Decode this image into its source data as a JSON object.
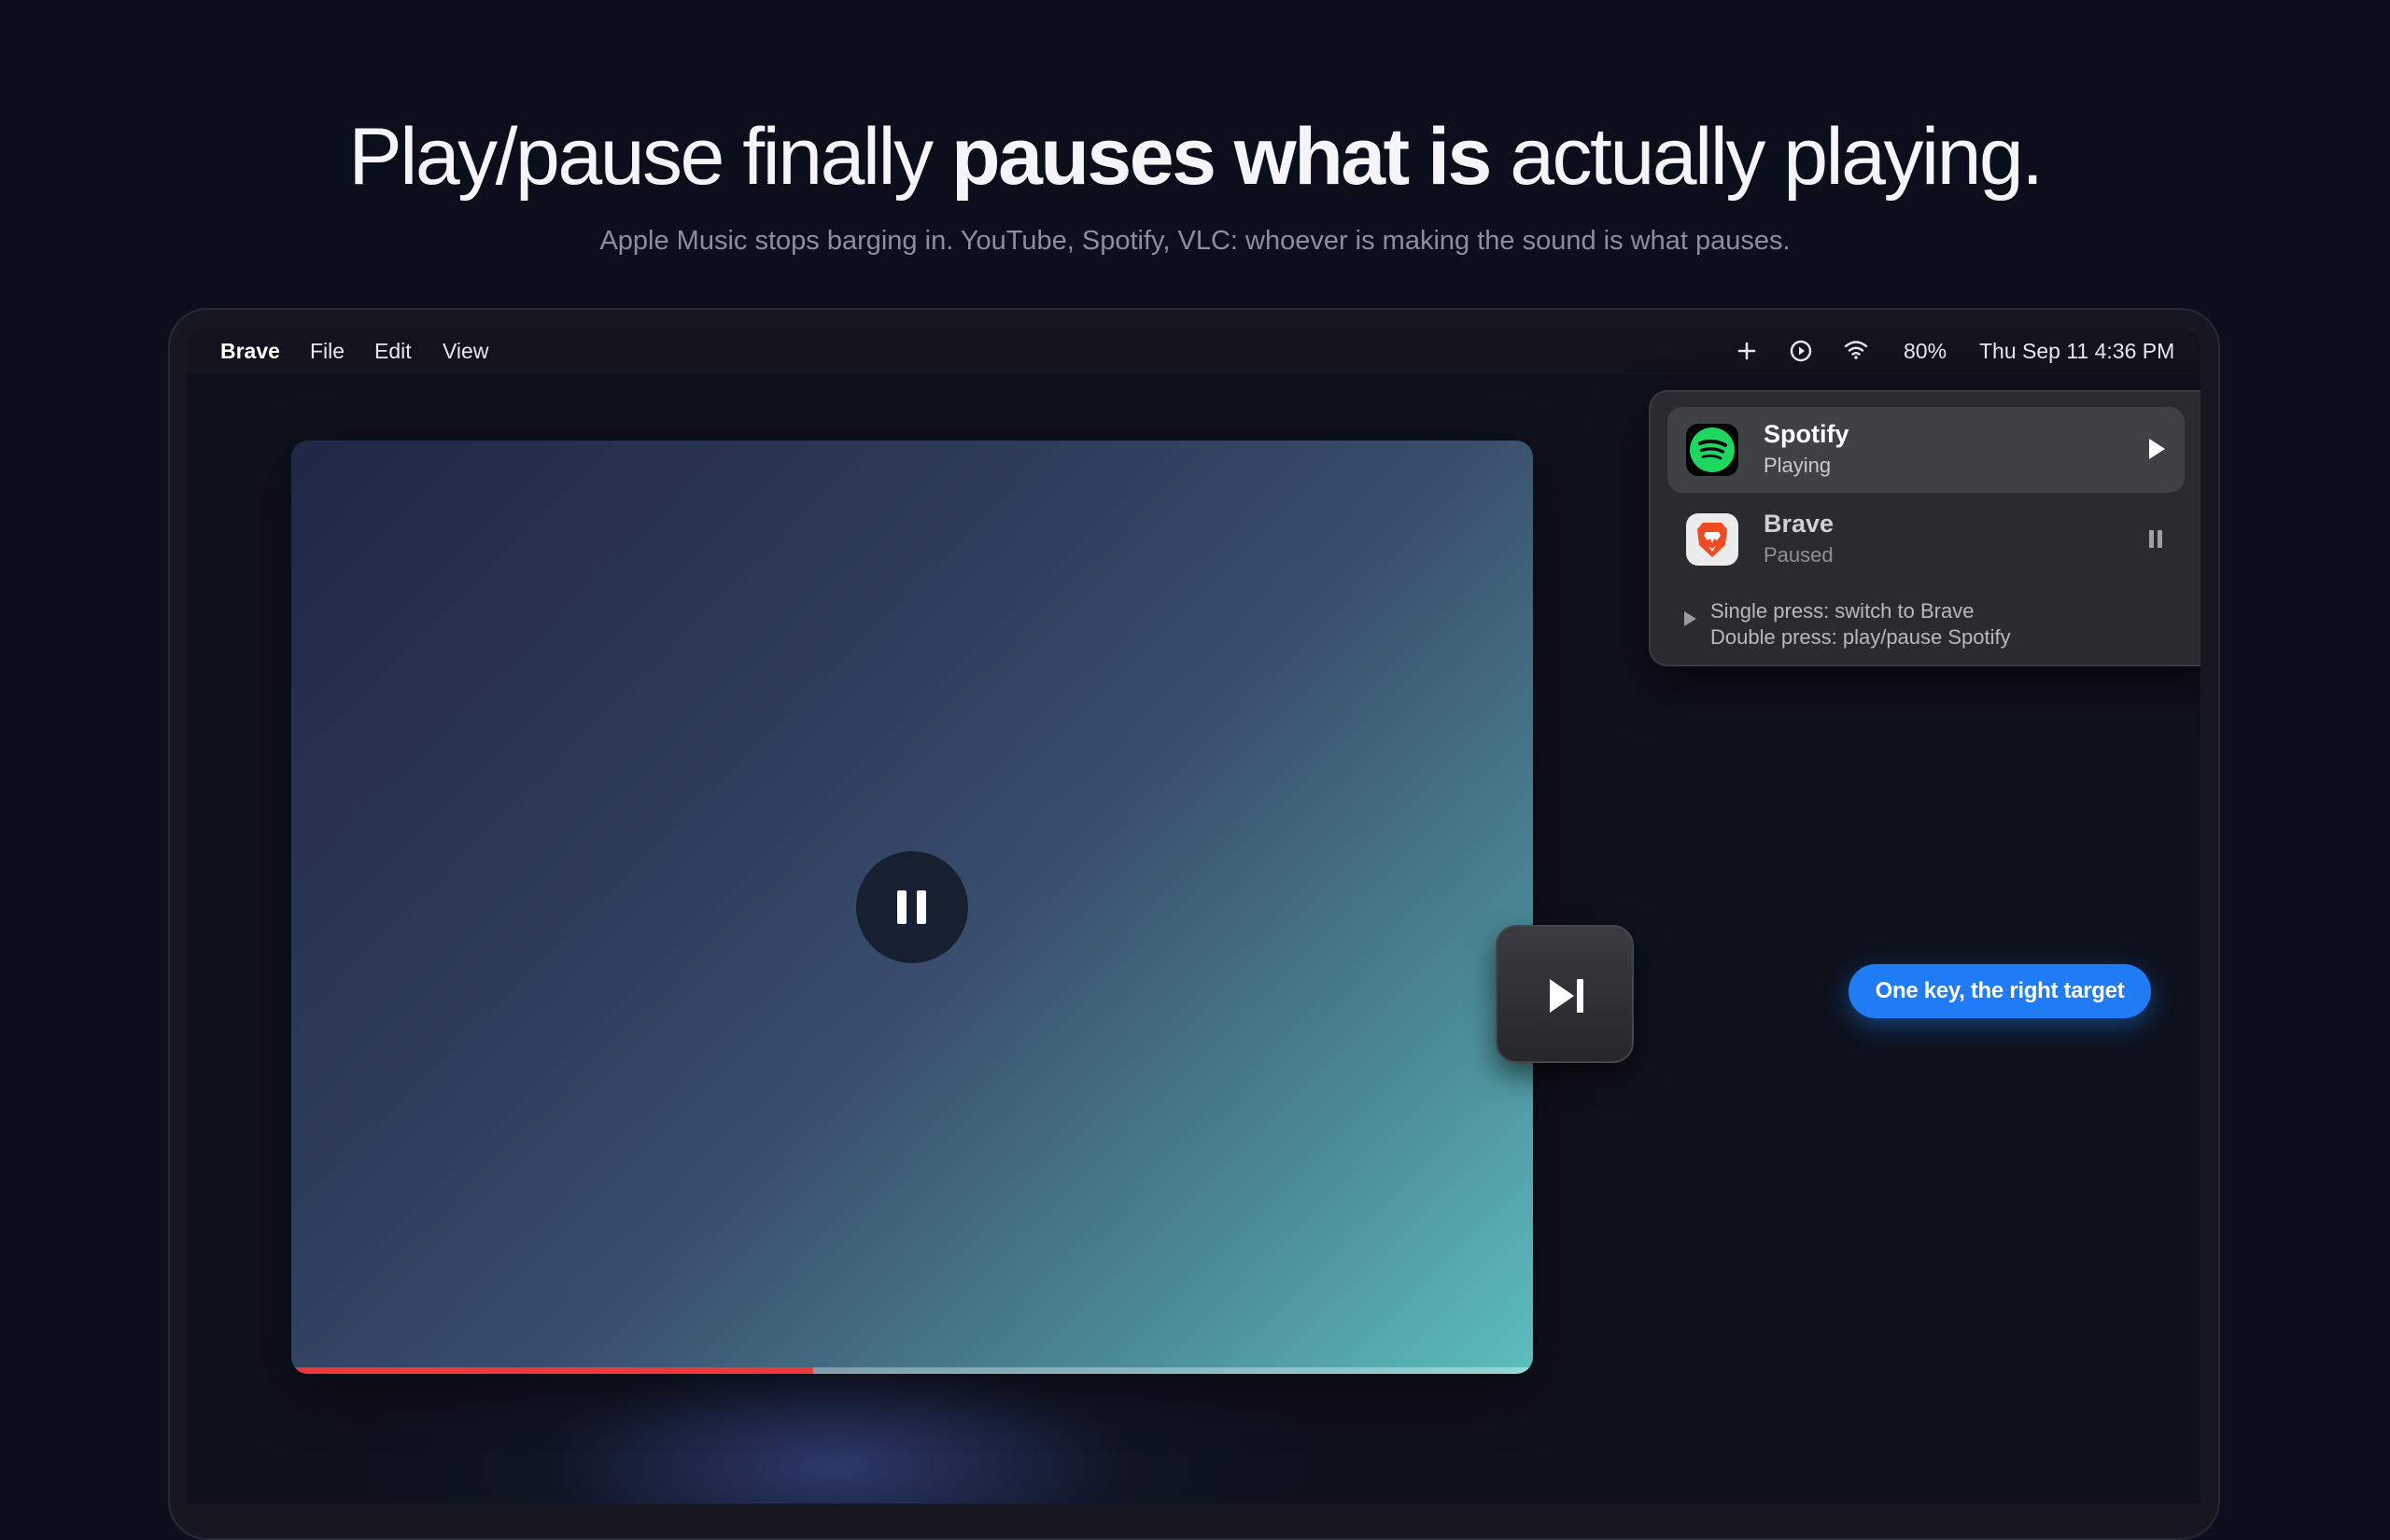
{
  "hero": {
    "headline_part1": "Play/pause finally ",
    "headline_bold": "pauses what is",
    "headline_part2": " actually playing.",
    "subheadline": "Apple Music stops barging in. YouTube, Spotify, VLC: whoever is making the sound is what pauses."
  },
  "menubar": {
    "app_name": "Brave",
    "menus": [
      "File",
      "Edit",
      "View"
    ],
    "status_icons": [
      "plus-icon",
      "play-circle-icon",
      "wifi-icon"
    ],
    "battery": "80%",
    "clock": "Thu Sep 11 4:36 PM"
  },
  "video": {
    "control_icon": "pause-icon",
    "progress_fraction": 0.42,
    "progress_color": "#f0383c"
  },
  "now_playing": {
    "sources": [
      {
        "name": "Spotify",
        "state": "Playing",
        "icon": "spotify-icon",
        "control": "play-icon",
        "active": true
      },
      {
        "name": "Brave",
        "state": "Paused",
        "icon": "brave-icon",
        "control": "pause-icon",
        "active": false
      }
    ],
    "hint_single": "Single press: switch to Brave",
    "hint_double": "Double press: play/pause Spotify"
  },
  "media_key": {
    "icon": "play-pause-next-icon",
    "callout": "One key, the right target",
    "accent": "#1f7cf5"
  }
}
